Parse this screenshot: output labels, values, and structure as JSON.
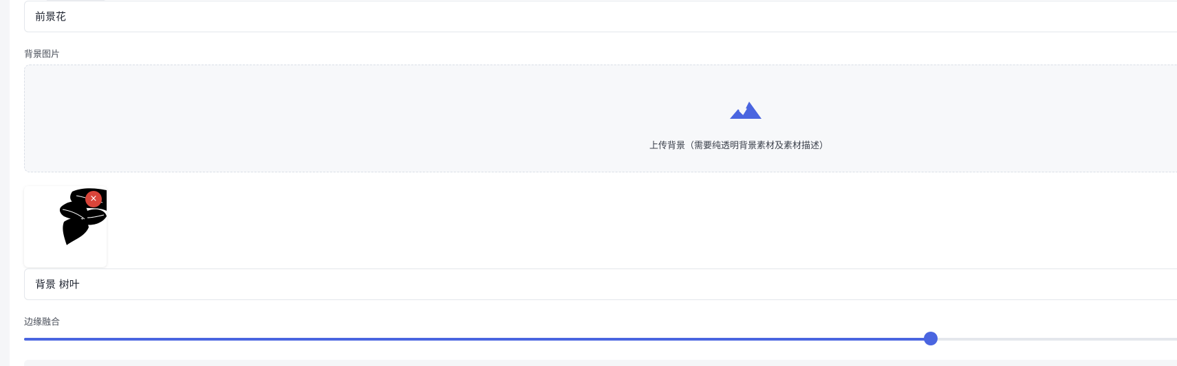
{
  "foreground": {
    "name_value": "前景花"
  },
  "background_image": {
    "label": "背景图片",
    "upload_text": "上传背景（需要纯透明背景素材及素材描述）",
    "icon": "mountain-image-icon",
    "remove_icon": "close-icon",
    "remove_glyph": "×",
    "description_value": "背景 树叶"
  },
  "edge_blend": {
    "label": "边缘融合",
    "value_fraction": 0.78
  },
  "colors": {
    "accent": "#4a65e0",
    "remove": "#d9453a"
  }
}
